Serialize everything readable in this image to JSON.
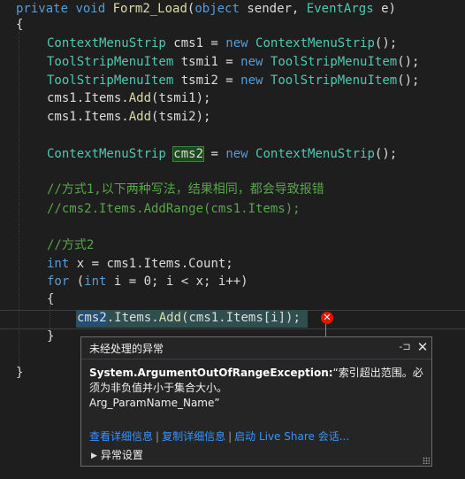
{
  "code": {
    "method_sig": {
      "kw1": "private",
      "kw2": "void",
      "name": "Form2_Load",
      "p1_type": "object",
      "p1_name": " sender, ",
      "p2_type": "EventArgs",
      "p2_name": " e)"
    },
    "open_brace": "{",
    "l_cms1": {
      "type": "ContextMenuStrip",
      "var": " cms1 = ",
      "kw": "new",
      "ctor": "ContextMenuStrip",
      "tail": "();"
    },
    "l_tsmi1": {
      "type": "ToolStripMenuItem",
      "var": " tsmi1 = ",
      "kw": "new",
      "ctor": "ToolStripMenuItem",
      "tail": "();"
    },
    "l_tsmi2": {
      "type": "ToolStripMenuItem",
      "var": " tsmi2 = ",
      "kw": "new",
      "ctor": "ToolStripMenuItem",
      "tail": "();"
    },
    "l_add1": {
      "pre": "cms1.Items.",
      "fn": "Add",
      "post": "(tsmi1);"
    },
    "l_add2": {
      "pre": "cms1.Items.",
      "fn": "Add",
      "post": "(tsmi2);"
    },
    "l_cms2": {
      "type": "ContextMenuStrip",
      "sp": " ",
      "var": "cms2",
      "mid": " = ",
      "kw": "new",
      "ctor": "ContextMenuStrip",
      "tail": "();"
    },
    "comment1": "//方式1,以下两种写法，结果相同，都会导致报错",
    "comment2": "//cms2.Items.AddRange(cms1.Items);",
    "comment3": "//方式2",
    "l_int": {
      "kw": "int",
      "rest": " x = cms1.Items.Count;"
    },
    "l_for": {
      "kw": "for",
      "p1": " (",
      "kw2": "int",
      "rest": " i = 0; i < x; i++)"
    },
    "inner_open": "{",
    "l_stmt": {
      "sel": "cms2",
      "pre": ".Items.",
      "fn": "Add",
      "post": "(cms1.Items[i]);"
    },
    "inner_close": "}",
    "close_brace": "}"
  },
  "popup": {
    "title": "未经处理的异常",
    "exception_type": "System.ArgumentOutOfRangeException:",
    "message": "“索引超出范围。必须为非负值并小于集合大小。\nArg_ParamName_Name”",
    "links": [
      "查看详细信息",
      "复制详细信息",
      "启动 Live Share 会话..."
    ],
    "settings_label": "异常设置"
  },
  "icons": {
    "pin": "pin-icon",
    "close": "close-icon",
    "error": "error-icon",
    "expand": "triangle-right-icon"
  },
  "colors": {
    "keyword": "#569cd6",
    "type": "#4ec9b0",
    "method": "#dcdcaa",
    "comment": "#57a64a",
    "link": "#3794ff",
    "error": "#e51400"
  }
}
